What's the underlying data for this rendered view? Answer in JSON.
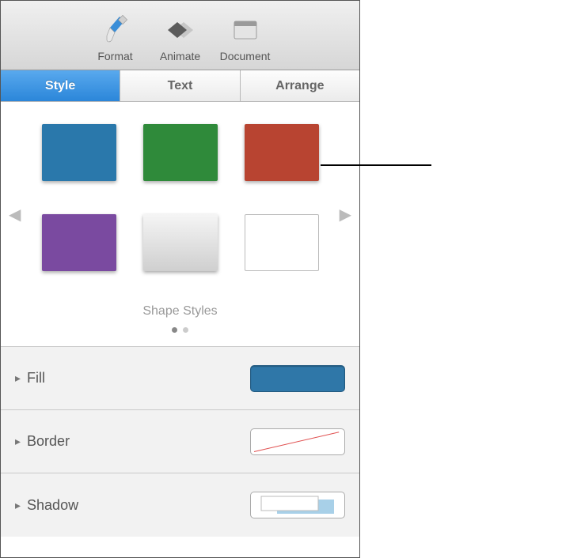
{
  "toolbar": {
    "format": "Format",
    "animate": "Animate",
    "document": "Document"
  },
  "tabs": {
    "style": "Style",
    "text": "Text",
    "arrange": "Arrange"
  },
  "swatches": [
    {
      "name": "blue",
      "color": "#2a78ab"
    },
    {
      "name": "green",
      "color": "#2f8a3a"
    },
    {
      "name": "red",
      "color": "#b84431"
    },
    {
      "name": "purple",
      "color": "#7a4aa0"
    },
    {
      "name": "gray",
      "color": "gray"
    },
    {
      "name": "outline",
      "color": "outline"
    }
  ],
  "caption": "Shape Styles",
  "props": {
    "fill": {
      "label": "Fill",
      "color": "#2f77a8"
    },
    "border": {
      "label": "Border"
    },
    "shadow": {
      "label": "Shadow"
    }
  }
}
